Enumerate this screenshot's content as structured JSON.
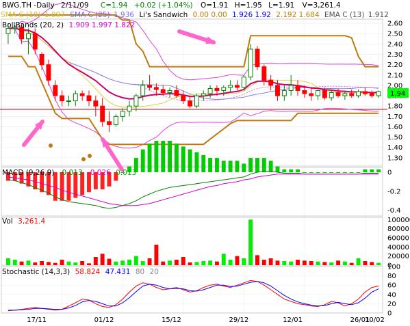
{
  "header": {
    "symbol": "BWG.TH -Daily",
    "date": "2/11/09",
    "close": "C=1.94",
    "change": "+0.02 (+1.04%)",
    "open": "O=1.91",
    "high": "H=1.95",
    "low": "L=1.91",
    "volume": "V=3,261.4"
  },
  "legend_main": [
    {
      "name": "SMA C (10)",
      "values": "1.897",
      "color": "#e0d040"
    },
    {
      "name": "SMA C (25)",
      "values": "1.936",
      "color": "#8080e0"
    },
    {
      "name": "Li's Sandwich",
      "values": "0.00  0.00",
      "color": "#c08000"
    },
    {
      "name": "",
      "values": "1.926  1.92",
      "color": "#0000ff"
    },
    {
      "name": "",
      "values": "2.192  1.684",
      "color": "#c08000"
    },
    {
      "name": "EMA C (13)",
      "values": "1.912",
      "color": "#606060"
    }
  ],
  "legend_boll": {
    "name": "BollBands (20, 2)",
    "values": "1.909  1.997  1.822",
    "color": "#cc00cc"
  },
  "legend_macd": {
    "name": "MACD (9,26,9)",
    "v1": "-0.013",
    "v2": "-0.026",
    "v3": "0.013",
    "color1": "#008000",
    "color2": "#cc00cc"
  },
  "legend_vol": {
    "name": "Vol",
    "value": "3,261.4",
    "color": "#ff0000"
  },
  "legend_stoch": {
    "name": "Stochastic (14,3,3)",
    "v1": "58.824",
    "v2": "47.431",
    "v3": "80",
    "v4": "20",
    "color1": "#ff0000",
    "color2": "#0000ff"
  },
  "last_price_tag": "1.94",
  "chart_data": {
    "type": "candlestick",
    "x_ticks": [
      "17/11",
      "01/12",
      "15/12",
      "29/12",
      "12/01",
      "26/01",
      "10/02"
    ],
    "price_ticks": [
      "2.60",
      "2.50",
      "2.40",
      "2.30",
      "2.20",
      "2.10",
      "2.00",
      "1.90",
      "1.80",
      "1.70",
      "1.60",
      "1.50",
      "1.40",
      "1.30"
    ],
    "macd_ticks": [
      "0",
      "-0.2",
      "-0.4"
    ],
    "vol_ticks": [
      "100000",
      "80000",
      "60000",
      "40000",
      "20000",
      "0"
    ],
    "stoch_ticks": [
      "100",
      "80",
      "60",
      "40",
      "20",
      "0"
    ],
    "price_range": [
      1.22,
      2.64
    ],
    "candles": [
      [
        2.5,
        2.6,
        2.4,
        2.55
      ],
      [
        2.55,
        2.58,
        2.5,
        2.56
      ],
      [
        2.56,
        2.6,
        2.4,
        2.45
      ],
      [
        2.45,
        2.55,
        2.3,
        2.5
      ],
      [
        2.5,
        2.55,
        2.3,
        2.35
      ],
      [
        2.3,
        2.32,
        2.15,
        2.2
      ],
      [
        2.2,
        2.25,
        2.0,
        2.05
      ],
      [
        2.0,
        2.05,
        1.85,
        1.9
      ],
      [
        1.9,
        1.95,
        1.8,
        1.85
      ],
      [
        1.85,
        1.9,
        1.8,
        1.85
      ],
      [
        1.85,
        1.95,
        1.8,
        1.92
      ],
      [
        1.92,
        1.95,
        1.85,
        1.9
      ],
      [
        1.9,
        1.95,
        1.8,
        1.85
      ],
      [
        1.85,
        1.9,
        1.7,
        1.8
      ],
      [
        1.8,
        1.88,
        1.6,
        1.65
      ],
      [
        1.65,
        1.75,
        1.55,
        1.62
      ],
      [
        1.62,
        1.72,
        1.6,
        1.7
      ],
      [
        1.7,
        1.78,
        1.65,
        1.75
      ],
      [
        1.75,
        1.85,
        1.7,
        1.8
      ],
      [
        1.8,
        1.92,
        1.75,
        1.9
      ],
      [
        1.9,
        2.05,
        1.85,
        2.0
      ],
      [
        2.0,
        2.1,
        1.95,
        1.98
      ],
      [
        1.98,
        2.02,
        1.9,
        1.96
      ],
      [
        1.96,
        2.0,
        1.9,
        1.93
      ],
      [
        1.93,
        1.98,
        1.88,
        1.95
      ],
      [
        1.95,
        2.0,
        1.88,
        1.9
      ],
      [
        1.9,
        1.95,
        1.82,
        1.85
      ],
      [
        1.85,
        1.9,
        1.78,
        1.8
      ],
      [
        1.8,
        1.92,
        1.78,
        1.9
      ],
      [
        1.9,
        1.95,
        1.85,
        1.92
      ],
      [
        1.92,
        2.0,
        1.88,
        1.97
      ],
      [
        1.97,
        2.0,
        1.9,
        1.95
      ],
      [
        1.95,
        2.0,
        1.9,
        1.98
      ],
      [
        1.98,
        2.05,
        1.93,
        2.0
      ],
      [
        2.0,
        2.05,
        1.95,
        1.98
      ],
      [
        1.98,
        2.1,
        1.95,
        2.08
      ],
      [
        2.08,
        2.4,
        2.05,
        2.35
      ],
      [
        2.35,
        2.38,
        2.15,
        2.18
      ],
      [
        2.18,
        2.2,
        2.0,
        2.05
      ],
      [
        2.05,
        2.1,
        1.95,
        2.0
      ],
      [
        2.0,
        2.05,
        1.85,
        1.9
      ],
      [
        1.9,
        2.0,
        1.85,
        1.95
      ],
      [
        1.95,
        2.1,
        1.9,
        2.0
      ],
      [
        2.0,
        2.05,
        1.9,
        1.95
      ],
      [
        1.95,
        2.0,
        1.88,
        1.92
      ],
      [
        1.92,
        1.98,
        1.85,
        1.9
      ],
      [
        1.9,
        1.96,
        1.86,
        1.95
      ],
      [
        1.95,
        1.98,
        1.86,
        1.88
      ],
      [
        1.88,
        1.95,
        1.85,
        1.93
      ],
      [
        1.93,
        1.97,
        1.88,
        1.9
      ],
      [
        1.9,
        1.95,
        1.86,
        1.92
      ],
      [
        1.92,
        1.96,
        1.88,
        1.9
      ],
      [
        1.9,
        1.96,
        1.88,
        1.94
      ],
      [
        1.94,
        1.98,
        1.9,
        1.92
      ],
      [
        1.92,
        1.95,
        1.88,
        1.9
      ],
      [
        1.9,
        1.95,
        1.88,
        1.94
      ]
    ],
    "volume": [
      15000,
      12000,
      8000,
      10000,
      6000,
      9000,
      7000,
      5000,
      12000,
      8000,
      6000,
      9000,
      4000,
      18000,
      25000,
      14000,
      8000,
      10000,
      12000,
      20000,
      9000,
      15000,
      45000,
      8000,
      10000,
      12000,
      18000,
      6000,
      7000,
      9000,
      10000,
      8000,
      25000,
      12000,
      20000,
      15000,
      100000,
      22000,
      12000,
      15000,
      10000,
      9000,
      8000,
      12000,
      10000,
      9000,
      8000,
      7000,
      6000,
      10000,
      8000,
      5000,
      15000,
      9000,
      7000,
      5000
    ],
    "macd": [
      -0.08,
      -0.09,
      -0.11,
      -0.13,
      -0.16,
      -0.19,
      -0.22,
      -0.26,
      -0.29,
      -0.31,
      -0.32,
      -0.33,
      -0.34,
      -0.35,
      -0.37,
      -0.38,
      -0.37,
      -0.35,
      -0.33,
      -0.3,
      -0.26,
      -0.23,
      -0.2,
      -0.18,
      -0.16,
      -0.15,
      -0.14,
      -0.13,
      -0.12,
      -0.11,
      -0.1,
      -0.09,
      -0.08,
      -0.07,
      -0.06,
      -0.05,
      -0.02,
      0.0,
      0.01,
      0.01,
      0.0,
      -0.01,
      -0.01,
      -0.01,
      -0.02,
      -0.02,
      -0.02,
      -0.02,
      -0.02,
      -0.02,
      -0.02,
      -0.02,
      -0.02,
      -0.01,
      -0.01,
      -0.01
    ],
    "signal": [
      -0.05,
      -0.06,
      -0.07,
      -0.08,
      -0.1,
      -0.12,
      -0.14,
      -0.16,
      -0.19,
      -0.21,
      -0.23,
      -0.25,
      -0.27,
      -0.29,
      -0.31,
      -0.33,
      -0.34,
      -0.35,
      -0.35,
      -0.35,
      -0.34,
      -0.33,
      -0.31,
      -0.29,
      -0.27,
      -0.25,
      -0.23,
      -0.21,
      -0.19,
      -0.17,
      -0.15,
      -0.14,
      -0.12,
      -0.11,
      -0.1,
      -0.08,
      -0.07,
      -0.05,
      -0.04,
      -0.03,
      -0.02,
      -0.02,
      -0.02,
      -0.02,
      -0.02,
      -0.02,
      -0.02,
      -0.02,
      -0.02,
      -0.02,
      -0.02,
      -0.02,
      -0.02,
      -0.02,
      -0.02,
      -0.02
    ],
    "stoch_k": [
      5,
      6,
      8,
      10,
      12,
      10,
      8,
      6,
      8,
      15,
      22,
      30,
      28,
      20,
      14,
      12,
      18,
      30,
      45,
      58,
      65,
      62,
      55,
      50,
      52,
      55,
      50,
      45,
      48,
      55,
      60,
      62,
      58,
      55,
      60,
      65,
      70,
      68,
      60,
      50,
      40,
      30,
      25,
      20,
      18,
      15,
      14,
      18,
      25,
      22,
      15,
      20,
      30,
      45,
      55,
      58
    ],
    "stoch_d": [
      6,
      6,
      7,
      8,
      10,
      10,
      9,
      8,
      8,
      11,
      16,
      24,
      27,
      25,
      20,
      15,
      15,
      22,
      33,
      46,
      58,
      62,
      60,
      55,
      52,
      53,
      52,
      48,
      47,
      50,
      55,
      60,
      60,
      57,
      58,
      62,
      66,
      68,
      65,
      58,
      48,
      38,
      30,
      24,
      20,
      17,
      15,
      16,
      20,
      23,
      20,
      18,
      22,
      32,
      45,
      52
    ]
  }
}
